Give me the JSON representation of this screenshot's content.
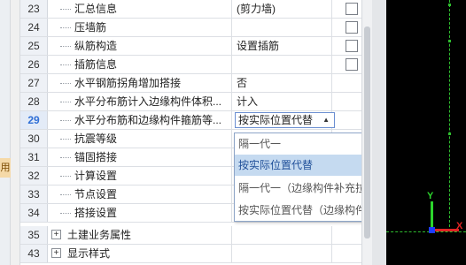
{
  "left_tab": {
    "label": "用"
  },
  "rows": [
    {
      "num": "23",
      "name": "汇总信息",
      "value": "(剪力墙)",
      "checkbox": true
    },
    {
      "num": "24",
      "name": "压墙筋",
      "value": "",
      "checkbox": true
    },
    {
      "num": "25",
      "name": "纵筋构造",
      "value": "设置插筋",
      "checkbox": true
    },
    {
      "num": "26",
      "name": "插筋信息",
      "value": "",
      "checkbox": true
    },
    {
      "num": "27",
      "name": "水平钢筋拐角增加搭接",
      "value": "否",
      "checkbox": false
    },
    {
      "num": "28",
      "name": "水平分布筋计入边缘构件体积...",
      "value": "计入",
      "checkbox": false
    },
    {
      "num": "29",
      "name": "水平分布筋和边缘构件箍筋等...",
      "value": "按实际位置代替",
      "checkbox": false,
      "current": true
    },
    {
      "num": "30",
      "name": "抗震等级",
      "value": "",
      "checkbox": false
    },
    {
      "num": "31",
      "name": "锚固搭接",
      "value": "",
      "checkbox": false
    },
    {
      "num": "32",
      "name": "计算设置",
      "value": "",
      "checkbox": false
    },
    {
      "num": "33",
      "name": "节点设置",
      "value": "",
      "checkbox": false
    },
    {
      "num": "34",
      "name": "搭接设置",
      "value": "",
      "checkbox": false
    },
    {
      "num": "35",
      "name": "土建业务属性",
      "value": "",
      "checkbox": false,
      "group": true
    },
    {
      "num": "43",
      "name": "显示样式",
      "value": "",
      "checkbox": false,
      "group": true
    }
  ],
  "combo": {
    "value": "按实际位置代替",
    "arrow": "▲"
  },
  "dropdown": {
    "options": [
      "隔一代一",
      "按实际位置代替",
      "隔一代一（边缘构件补充拉筋）",
      "按实际位置代替（边缘构件补充拉筋）"
    ],
    "selected_index": 1
  },
  "canvas": {
    "axis_y_label": "Y",
    "axis_x_label": "X"
  },
  "colors": {
    "selected_bg": "#c5daf0",
    "current_row_num": "#2f6fd6",
    "canvas_bg": "#000000"
  }
}
